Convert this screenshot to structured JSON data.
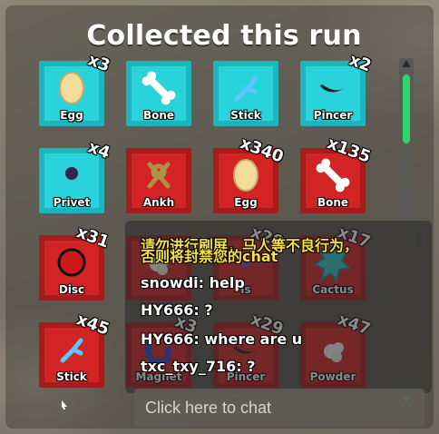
{
  "title": "Collected this run",
  "items": [
    {
      "label": "Egg",
      "count": "x3",
      "rarity": "cyan",
      "icon": "egg-icon"
    },
    {
      "label": "Bone",
      "count": "",
      "rarity": "cyan",
      "icon": "bone-icon"
    },
    {
      "label": "Stick",
      "count": "",
      "rarity": "cyan",
      "icon": "stick-icon"
    },
    {
      "label": "Pincer",
      "count": "x2",
      "rarity": "cyan",
      "icon": "pincer-icon"
    },
    {
      "label": "Privet",
      "count": "x4",
      "rarity": "cyan",
      "icon": "privet-icon"
    },
    {
      "label": "Ankh",
      "count": "",
      "rarity": "red",
      "icon": "ankh-icon"
    },
    {
      "label": "Egg",
      "count": "x340",
      "rarity": "red",
      "icon": "egg-icon"
    },
    {
      "label": "Bone",
      "count": "x135",
      "rarity": "red",
      "icon": "bone-icon"
    },
    {
      "label": "Disc",
      "count": "x31",
      "rarity": "red",
      "icon": "disc-icon"
    },
    {
      "label": "",
      "count": "",
      "rarity": "red",
      "icon": "powder-icon"
    },
    {
      "label": "is",
      "count": "x20",
      "rarity": "red",
      "icon": "unknown-icon"
    },
    {
      "label": "Cactus",
      "count": "x17",
      "rarity": "red",
      "icon": "cactus-icon"
    },
    {
      "label": "Stick",
      "count": "x45",
      "rarity": "red",
      "icon": "stick-icon"
    },
    {
      "label": "Magnet",
      "count": "x3",
      "rarity": "red",
      "icon": "magnet-icon"
    },
    {
      "label": "Pincer",
      "count": "x29",
      "rarity": "red",
      "icon": "pincer-icon"
    },
    {
      "label": "Powder",
      "count": "x47",
      "rarity": "red",
      "icon": "powder-icon"
    }
  ],
  "chat": {
    "messages": [
      {
        "text": "请勿进行刷屏，马人等不良行为，",
        "type": "system"
      },
      {
        "text": "否则将封禁您的chat",
        "type": "system"
      },
      {
        "text": "snowdi: help",
        "type": "user"
      },
      {
        "text": "HY666: ?",
        "type": "user"
      },
      {
        "text": "HY666: where are u",
        "type": "user"
      },
      {
        "text": "txc_txy_716: ?",
        "type": "user"
      }
    ],
    "input_placeholder": "Click here to chat"
  },
  "colors": {
    "cyan_border": "#1cb5bd",
    "cyan_fill": "#2ad3dc",
    "red_border": "#a51c1c",
    "red_fill": "#d32424",
    "scroll_thumb": "#2ed36a",
    "system_text": "#f6e04a"
  }
}
